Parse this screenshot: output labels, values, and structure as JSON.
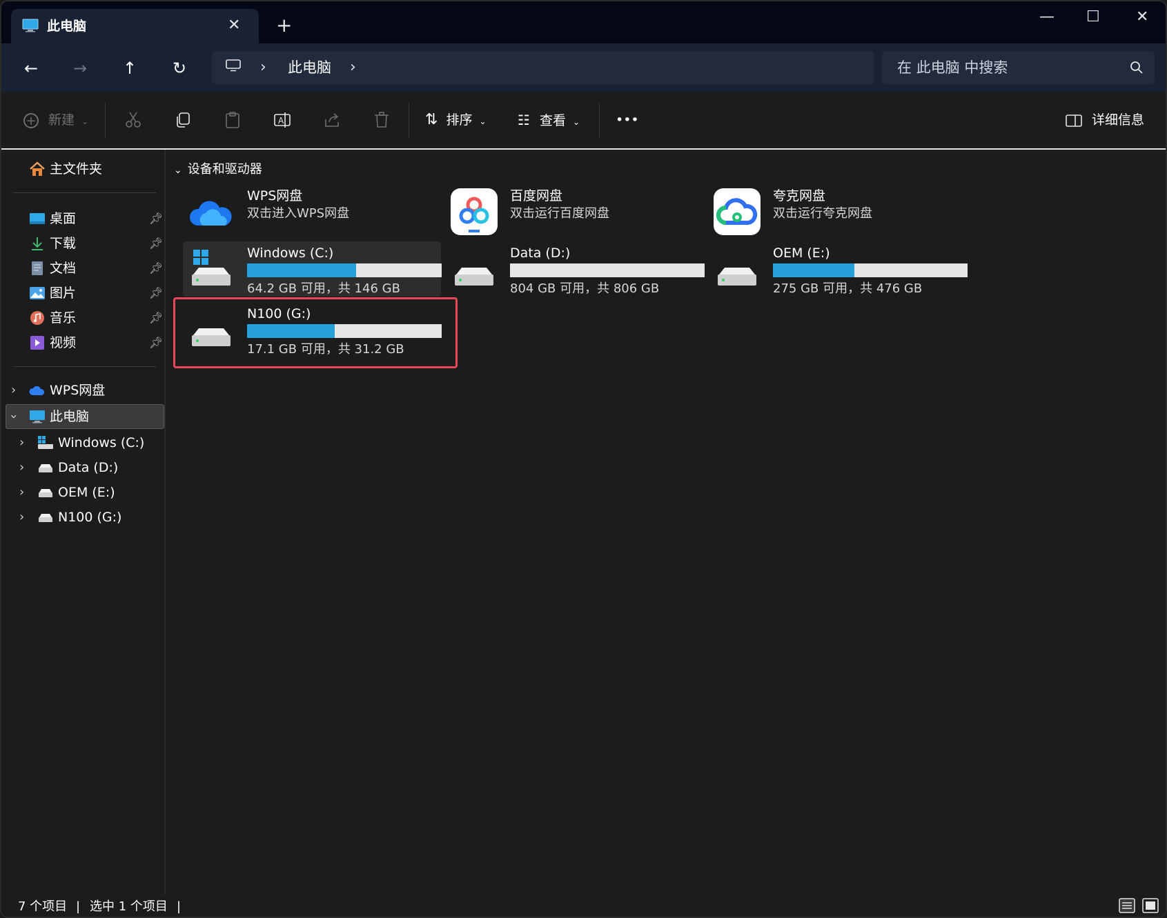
{
  "window": {
    "tab_title": "此电脑",
    "close_tab": "✕",
    "new_tab": "+",
    "minimize": "—",
    "maximize": "☐",
    "close": "✕"
  },
  "nav": {
    "back": "←",
    "forward": "→",
    "up": "↑",
    "refresh": "↻",
    "breadcrumb": [
      "此电脑"
    ],
    "search_placeholder": "在 此电脑 中搜索"
  },
  "toolbar": {
    "new_label": "新建",
    "sort_label": "排序",
    "view_label": "查看",
    "more_label": "•••",
    "details_label": "详细信息"
  },
  "sidebar": {
    "home": "主文件夹",
    "quick": [
      {
        "label": "桌面",
        "icon": "desktop-icon"
      },
      {
        "label": "下载",
        "icon": "download-icon"
      },
      {
        "label": "文档",
        "icon": "document-icon"
      },
      {
        "label": "图片",
        "icon": "pictures-icon"
      },
      {
        "label": "音乐",
        "icon": "music-icon"
      },
      {
        "label": "视频",
        "icon": "video-icon"
      }
    ],
    "wps": "WPS网盘",
    "this_pc": "此电脑",
    "drives": [
      "Windows (C:)",
      "Data (D:)",
      "OEM (E:)",
      "N100 (G:)"
    ]
  },
  "content": {
    "group_title": "设备和驱动器",
    "clouds": [
      {
        "name": "WPS网盘",
        "desc": "双击进入WPS网盘"
      },
      {
        "name": "百度网盘",
        "desc": "双击运行百度网盘"
      },
      {
        "name": "夸克网盘",
        "desc": "双击运行夸克网盘"
      }
    ],
    "drives": [
      {
        "name": "Windows (C:)",
        "free_text": "64.2 GB 可用，共 146 GB",
        "used_fraction": 0.56
      },
      {
        "name": "Data (D:)",
        "free_text": "804 GB 可用，共 806 GB",
        "used_fraction": 0.0
      },
      {
        "name": "OEM (E:)",
        "free_text": "275 GB 可用，共 476 GB",
        "used_fraction": 0.42
      },
      {
        "name": "N100 (G:)",
        "free_text": "17.1 GB 可用，共 31.2 GB",
        "used_fraction": 0.45
      }
    ]
  },
  "status": {
    "items": "7 个项目",
    "selected": "选中 1 个项目"
  },
  "colors": {
    "accent": "#26a0da",
    "highlight": "#e8475a",
    "titlebar": "#050917",
    "navbar": "#192235",
    "background": "#1c1c1c"
  }
}
